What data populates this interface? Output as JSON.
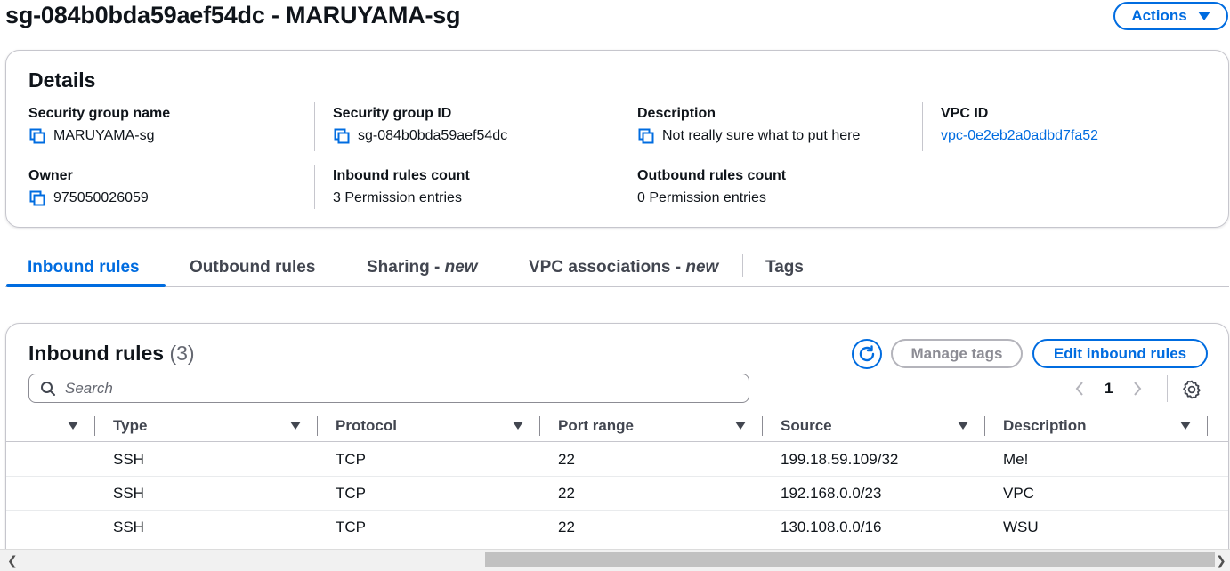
{
  "header": {
    "title": "sg-084b0bda59aef54dc - MARUYAMA-sg",
    "actions_label": "Actions"
  },
  "details": {
    "title": "Details",
    "fields": {
      "sg_name": {
        "label": "Security group name",
        "value": "MARUYAMA-sg"
      },
      "sg_id": {
        "label": "Security group ID",
        "value": "sg-084b0bda59aef54dc"
      },
      "description": {
        "label": "Description",
        "value": "Not really sure what to put here"
      },
      "vpc_id": {
        "label": "VPC ID",
        "value": "vpc-0e2eb2a0adbd7fa52"
      },
      "owner": {
        "label": "Owner",
        "value": "975050026059"
      },
      "inbound_count": {
        "label": "Inbound rules count",
        "value": "3 Permission entries"
      },
      "outbound_count": {
        "label": "Outbound rules count",
        "value": "0 Permission entries"
      }
    }
  },
  "tabs": [
    {
      "label": "Inbound rules",
      "active": true
    },
    {
      "label": "Outbound rules"
    },
    {
      "label": "Sharing - ",
      "suffix": "new"
    },
    {
      "label": "VPC associations - ",
      "suffix": "new"
    },
    {
      "label": "Tags"
    }
  ],
  "rules": {
    "title": "Inbound rules",
    "count": "(3)",
    "manage_tags_label": "Manage tags",
    "edit_label": "Edit inbound rules",
    "search_placeholder": "Search",
    "page": "1",
    "columns": [
      "Type",
      "Protocol",
      "Port range",
      "Source",
      "Description"
    ],
    "rows": [
      {
        "type": "SSH",
        "protocol": "TCP",
        "port": "22",
        "source": "199.18.59.109/32",
        "description": "Me!"
      },
      {
        "type": "SSH",
        "protocol": "TCP",
        "port": "22",
        "source": "192.168.0.0/23",
        "description": "VPC"
      },
      {
        "type": "SSH",
        "protocol": "TCP",
        "port": "22",
        "source": "130.108.0.0/16",
        "description": "WSU"
      }
    ]
  },
  "colors": {
    "accent": "#006ce0",
    "text": "#0f141a",
    "border": "#c6c6cd"
  },
  "icons": [
    "copy-icon",
    "refresh-icon",
    "search-icon",
    "settings-icon",
    "chevron-left-icon",
    "chevron-right-icon",
    "caret-down-icon"
  ]
}
